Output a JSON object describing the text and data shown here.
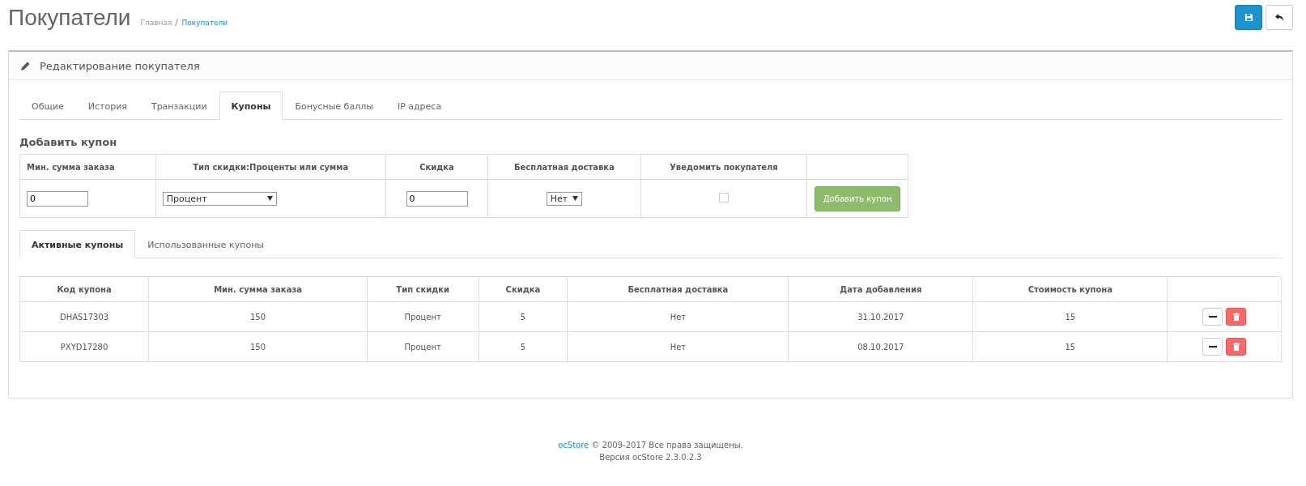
{
  "page": {
    "title": "Покупатели",
    "breadcrumbs": [
      {
        "label": "Главная",
        "current": false
      },
      {
        "label": "Покупатели",
        "current": true
      }
    ]
  },
  "panel": {
    "title": "Редактирование покупателя"
  },
  "tabs": [
    {
      "label": "Общие",
      "selected": false
    },
    {
      "label": "История",
      "selected": false
    },
    {
      "label": "Транзакции",
      "selected": false
    },
    {
      "label": "Купоны",
      "selected": true
    },
    {
      "label": "Бонусные баллы",
      "selected": false
    },
    {
      "label": "IP адреса",
      "selected": false
    }
  ],
  "add_coupon": {
    "heading": "Добавить купон",
    "columns": [
      "Мин. сумма заказа",
      "Тип скидки:Проценты или сумма",
      "Скидка",
      "Бесплатная доставка",
      "Уведомить покупателя"
    ],
    "min_total": "0",
    "discount_type": "Процент",
    "discount": "0",
    "free_shipping": "Нет",
    "notify_checked": false,
    "button": "Добавить купон"
  },
  "coupon_tabs": [
    {
      "label": "Активные купоны",
      "selected": true
    },
    {
      "label": "Использованные купоны",
      "selected": false
    }
  ],
  "coupons": {
    "columns": [
      "Код купона",
      "Мин. сумма заказа",
      "Тип скидки",
      "Скидка",
      "Бесплатная доставка",
      "Дата добавления",
      "Стоимость купона"
    ],
    "rows": [
      [
        "DHAS17303",
        "150",
        "Процент",
        "5",
        "Нет",
        "31.10.2017",
        "15"
      ],
      [
        "PXYD17280",
        "150",
        "Процент",
        "5",
        "Нет",
        "08.10.2017",
        "15"
      ]
    ]
  },
  "footer": {
    "link": "ocStore",
    "text": "© 2009-2017 Все права защищены.",
    "version": "Версия ocStore 2.3.0.2.3"
  }
}
